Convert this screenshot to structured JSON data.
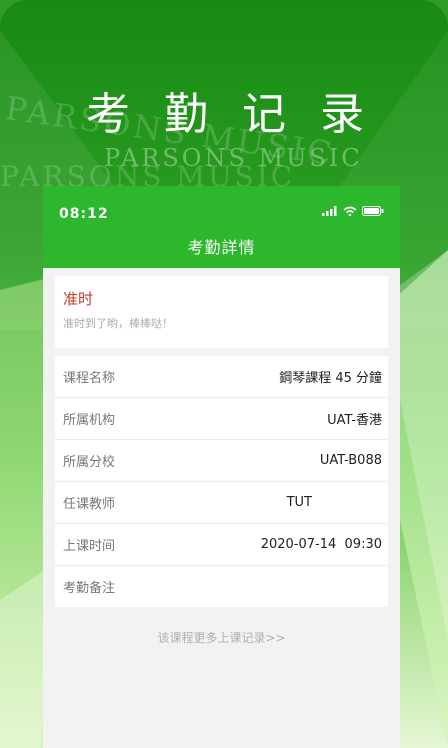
{
  "hero": {
    "title": "考勤记录",
    "watermark": "PARSONS MUSIC"
  },
  "status_bar": {
    "time": "08:12"
  },
  "nav": {
    "title": "考勤詳情"
  },
  "attendance_status": {
    "title": "准时",
    "subtitle": "准时到了哟，棒棒哒！"
  },
  "details": [
    {
      "label": "课程名称",
      "value": "鋼琴課程 45 分鐘"
    },
    {
      "label": "所属机构",
      "value": "UAT-香港"
    },
    {
      "label": "所属分校",
      "value": "UAT-B088"
    },
    {
      "label": "任课教师",
      "value": "TUT"
    },
    {
      "label": "上课时间",
      "value": "2020-07-14  09:30"
    },
    {
      "label": "考勤备注",
      "value": ""
    }
  ],
  "more_link": "该课程更多上课记录>>",
  "colors": {
    "header_green": "#2db72d",
    "status_red": "#c23a2b"
  }
}
